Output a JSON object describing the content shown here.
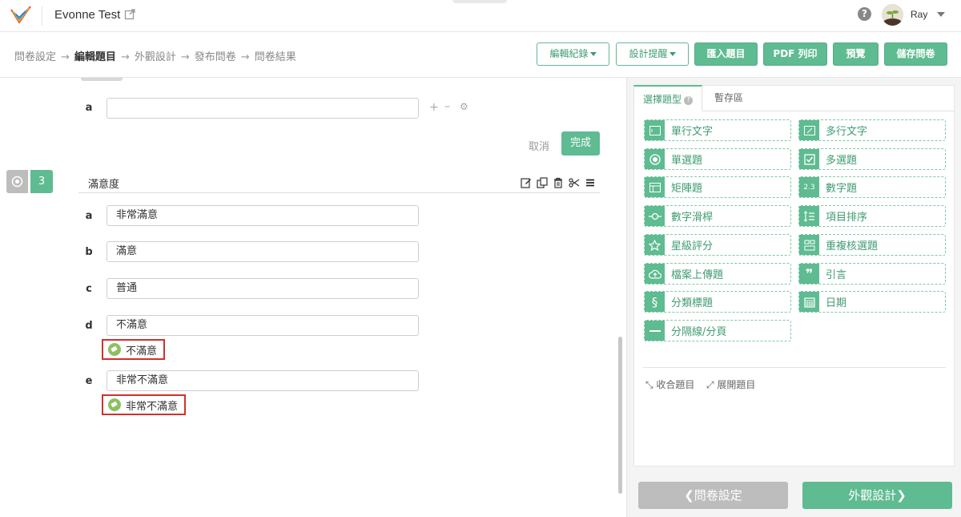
{
  "header": {
    "app_title": "Evonne Test",
    "user_name": "Ray"
  },
  "steps": [
    {
      "label": "問卷設定",
      "active": false
    },
    {
      "label": "編輯題目",
      "active": true
    },
    {
      "label": "外觀設計",
      "active": false
    },
    {
      "label": "發布問卷",
      "active": false
    },
    {
      "label": "問卷結果",
      "active": false
    }
  ],
  "step_arrow": "→",
  "toolbar": {
    "edit_log": "編輯紀錄",
    "design_tips": "設計提醒",
    "import": "匯入題目",
    "pdf": "PDF 列印",
    "preview": "預覽",
    "save": "儲存問卷"
  },
  "prev_question": {
    "option_letter": "a",
    "option_value": "",
    "cancel": "取消",
    "done": "完成"
  },
  "question": {
    "number": "3",
    "title": "滿意度",
    "options": [
      {
        "letter": "a",
        "value": "非常滿意",
        "tag": ""
      },
      {
        "letter": "b",
        "value": "滿意",
        "tag": ""
      },
      {
        "letter": "c",
        "value": "普通",
        "tag": ""
      },
      {
        "letter": "d",
        "value": "不滿意",
        "tag": "不滿意"
      },
      {
        "letter": "e",
        "value": "非常不滿意",
        "tag": "非常不滿意"
      }
    ]
  },
  "right_panel": {
    "tabs": [
      "選擇題型",
      "暫存區"
    ],
    "question_types": [
      {
        "label": "單行文字",
        "icon": "single-line-icon"
      },
      {
        "label": "多行文字",
        "icon": "multi-line-icon"
      },
      {
        "label": "單選題",
        "icon": "radio-icon"
      },
      {
        "label": "多選題",
        "icon": "checkbox-icon"
      },
      {
        "label": "矩陣題",
        "icon": "matrix-icon"
      },
      {
        "label": "數字題",
        "icon": "number-icon"
      },
      {
        "label": "數字滑桿",
        "icon": "slider-icon"
      },
      {
        "label": "項目排序",
        "icon": "sort-icon"
      },
      {
        "label": "星級評分",
        "icon": "star-icon"
      },
      {
        "label": "重複核選題",
        "icon": "repeat-check-icon"
      },
      {
        "label": "檔案上傳題",
        "icon": "cloud-upload-icon"
      },
      {
        "label": "引言",
        "icon": "quote-icon"
      },
      {
        "label": "分類標題",
        "icon": "section-icon"
      },
      {
        "label": "日期",
        "icon": "calendar-icon"
      },
      {
        "label": "分隔線/分頁",
        "icon": "divider-icon"
      }
    ],
    "collapse": "收合題目",
    "expand": "展開題目"
  },
  "footer": {
    "prev": "問卷設定",
    "next": "外觀設計"
  },
  "colors": {
    "brand_green": "#5fbb91",
    "tag_border_red": "#d0312d",
    "tag_green": "#8dc063"
  }
}
